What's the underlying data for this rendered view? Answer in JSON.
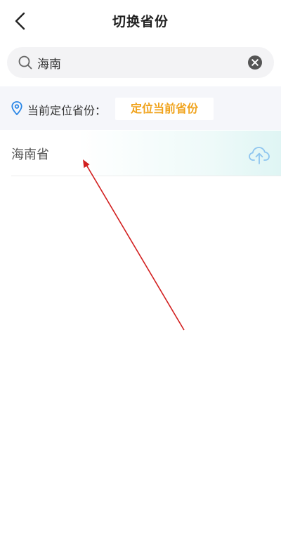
{
  "header": {
    "title": "切换省份",
    "back_icon": "chevron-left-icon"
  },
  "search": {
    "value": "海南",
    "search_icon": "search-icon",
    "clear_icon": "clear-circle-icon"
  },
  "location": {
    "icon": "location-pin-icon",
    "label": "当前定位省份：",
    "button_label": "定位当前省份"
  },
  "results": [
    {
      "label": "海南省",
      "icon": "cloud-upload-icon"
    }
  ],
  "colors": {
    "accent_orange": "#f0a31c",
    "pin_blue": "#2a86e6",
    "cloud_blue": "#8ec5ef",
    "annotation_red": "#d21f1f"
  }
}
